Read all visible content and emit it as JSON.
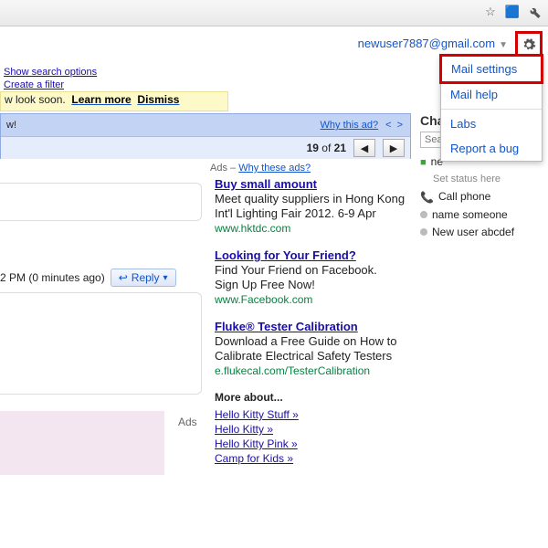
{
  "account": {
    "email": "newuser7887@gmail.com"
  },
  "search": {
    "show_options": "Show search options",
    "create_filter": "Create a filter"
  },
  "notice": {
    "prefix": "w look soon.",
    "learn": "Learn more",
    "dismiss": "Dismiss"
  },
  "bluebar": {
    "left": "w!",
    "why": "Why this ad?",
    "counter_pre": "19",
    "counter_mid": " of ",
    "counter_post": "21"
  },
  "ads_header": {
    "label": "Ads – ",
    "why": "Why these ads?"
  },
  "ads": [
    {
      "title": "Buy small amount",
      "line1": "Meet quality suppliers in Hong Kong",
      "line2": "Int'l Lighting Fair 2012. 6-9 Apr",
      "url": "www.hktdc.com"
    },
    {
      "title": "Looking for Your Friend?",
      "line1": "Find Your Friend on Facebook.",
      "line2": "Sign Up Free Now!",
      "url": "www.Facebook.com"
    },
    {
      "title": "Fluke® Tester Calibration",
      "line1": "Download a Free Guide on How to",
      "line2": "Calibrate Electrical Safety Testers",
      "url": "e.flukecal.com/TesterCalibration"
    }
  ],
  "more_about": {
    "heading": "More about...",
    "links": [
      "Hello Kitty Stuff »",
      "Hello Kitty »",
      "Hello Kitty Pink »",
      "Camp for Kids »"
    ]
  },
  "msg": {
    "time": "2 PM (0 minutes ago)",
    "reply": "Reply"
  },
  "ads_label": "Ads",
  "chat": {
    "title": "Chat",
    "search_placeholder": "Sea",
    "status": "Set status here",
    "items": [
      {
        "icon": "cam",
        "name": "ne"
      },
      {
        "icon": "phone",
        "name": "Call phone"
      },
      {
        "icon": "grey",
        "name": "name someone"
      },
      {
        "icon": "grey",
        "name": "New user abcdef"
      }
    ]
  },
  "menu": {
    "mail_settings": "Mail settings",
    "mail_help": "Mail help",
    "labs": "Labs",
    "report": "Report a bug"
  }
}
